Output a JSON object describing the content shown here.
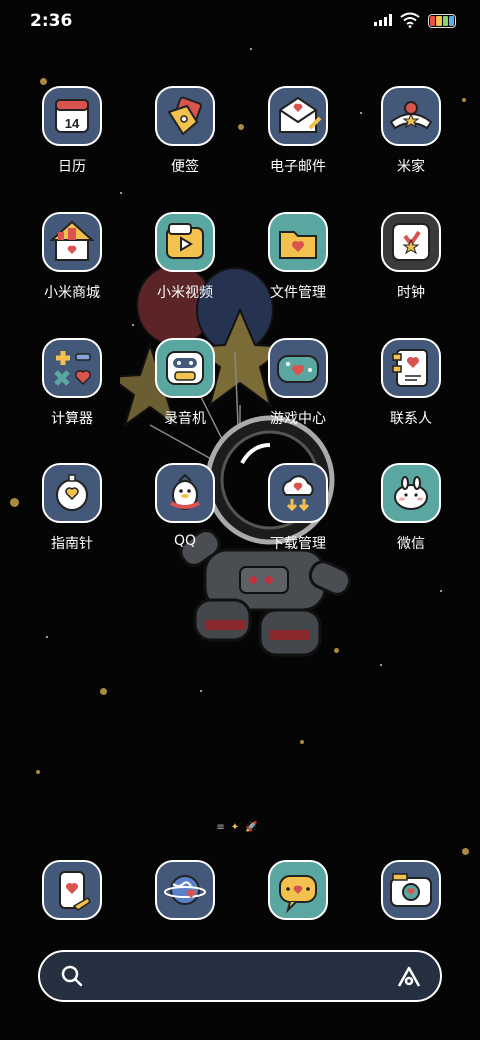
{
  "status": {
    "time": "2:36"
  },
  "apps": [
    {
      "label": "日历",
      "icon": "calendar-icon",
      "extra": "14",
      "bg": "#44587a"
    },
    {
      "label": "便签",
      "icon": "notes-icon",
      "bg": "#44587a"
    },
    {
      "label": "电子邮件",
      "icon": "email-icon",
      "bg": "#44587a"
    },
    {
      "label": "米家",
      "icon": "mijia-icon",
      "bg": "#44587a"
    },
    {
      "label": "小米商城",
      "icon": "mi-store-icon",
      "bg": "#44587a"
    },
    {
      "label": "小米视频",
      "icon": "mi-video-icon",
      "bg": "#5aa6a0"
    },
    {
      "label": "文件管理",
      "icon": "file-manager-icon",
      "bg": "#5aa6a0"
    },
    {
      "label": "时钟",
      "icon": "clock-icon",
      "bg": "#3a3a3a"
    },
    {
      "label": "计算器",
      "icon": "calculator-icon",
      "bg": "#44587a"
    },
    {
      "label": "录音机",
      "icon": "recorder-icon",
      "bg": "#5aa6a0"
    },
    {
      "label": "游戏中心",
      "icon": "game-center-icon",
      "bg": "#44587a"
    },
    {
      "label": "联系人",
      "icon": "contacts-icon",
      "bg": "#44587a"
    },
    {
      "label": "指南针",
      "icon": "compass-icon",
      "bg": "#44587a"
    },
    {
      "label": "QQ",
      "icon": "qq-icon",
      "bg": "#44587a"
    },
    {
      "label": "下载管理",
      "icon": "download-manager-icon",
      "bg": "#44587a"
    },
    {
      "label": "微信",
      "icon": "wechat-icon",
      "bg": "#5aa6a0"
    }
  ],
  "dock": [
    {
      "icon": "phone-icon",
      "bg": "#44587a"
    },
    {
      "icon": "browser-icon",
      "bg": "#44587a"
    },
    {
      "icon": "messages-icon",
      "bg": "#5aa6a0"
    },
    {
      "icon": "camera-icon",
      "bg": "#44587a"
    }
  ],
  "colors": {
    "accent_yellow": "#f2c14e",
    "accent_red": "#d9534f",
    "tile_blue": "#44587a",
    "tile_teal": "#5aa6a0"
  }
}
